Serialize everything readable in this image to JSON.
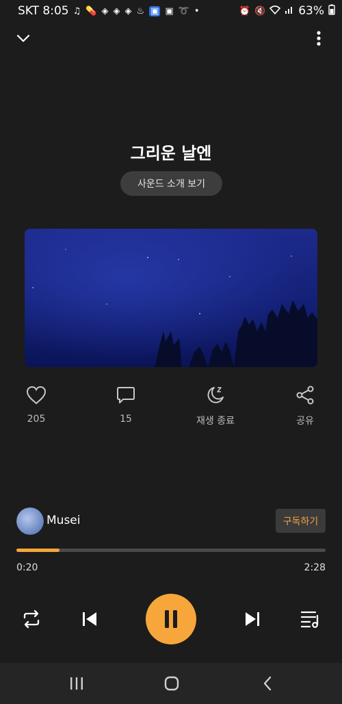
{
  "status_bar": {
    "carrier_time": "SKT 8:05",
    "battery": "63%"
  },
  "track": {
    "title": "그리운 날엔",
    "intro_button": "사운드 소개 보기"
  },
  "actions": {
    "like_count": "205",
    "comment_count": "15",
    "sleep_timer_label": "재생 종료",
    "share_label": "공유"
  },
  "artist": {
    "name": "Musei",
    "subscribe_label": "구독하기"
  },
  "playback": {
    "current_time": "0:20",
    "total_time": "2:28",
    "progress_fraction": 0.14,
    "state": "playing"
  },
  "colors": {
    "accent": "#f6a63a",
    "background": "#1c1c1c"
  },
  "icons": {
    "collapse": "chevron-down-icon",
    "more": "more-vert-icon",
    "like": "heart-icon",
    "comment": "comment-icon",
    "sleep": "moon-icon",
    "share": "share-icon",
    "repeat": "repeat-icon",
    "previous": "skip-previous-icon",
    "pause": "pause-icon",
    "next": "skip-next-icon",
    "playlist": "playlist-icon"
  }
}
